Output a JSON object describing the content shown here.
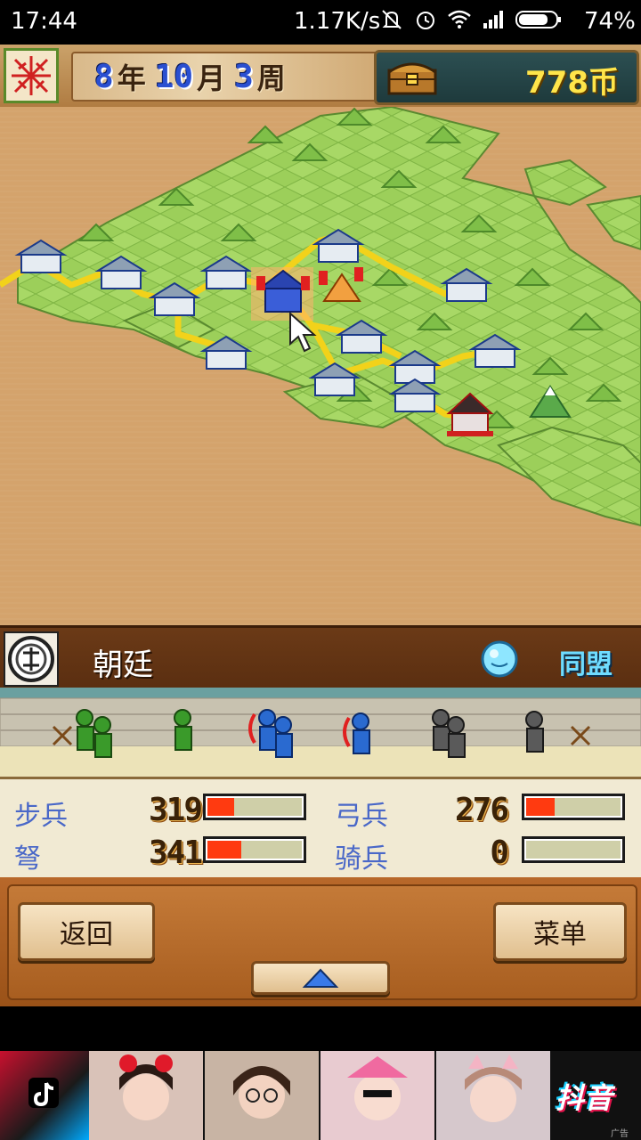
{
  "status_bar": {
    "time": "17:44",
    "net_speed": "1.17K/s",
    "battery_percent": "74%",
    "icons": [
      "mute-icon",
      "alarm-icon",
      "wifi-icon",
      "signal-icon",
      "battery-icon"
    ]
  },
  "top_bar": {
    "date": {
      "year": "8",
      "year_unit": "年",
      "month": "10",
      "month_unit": "月",
      "week": "3",
      "week_unit": "周"
    },
    "money": "778币"
  },
  "faction": {
    "name": "朝廷",
    "relation": "同盟"
  },
  "stats": [
    {
      "label": "步兵",
      "value": "319",
      "fill": 0.28
    },
    {
      "label": "弓兵",
      "value": "276",
      "fill": 0.3
    },
    {
      "label": "弩",
      "value": "341",
      "fill": 0.36
    },
    {
      "label": "骑兵",
      "value": "0",
      "fill": 0
    }
  ],
  "controls": {
    "back_label": "返回",
    "menu_label": "菜单"
  },
  "ad": {
    "brand": "抖音",
    "note": "广告"
  },
  "colors": {
    "gold_text": "#ffe54a",
    "ally_blue": "#6fdcff",
    "bar_fill": "#ff3a10",
    "road": "#f2d21a"
  }
}
